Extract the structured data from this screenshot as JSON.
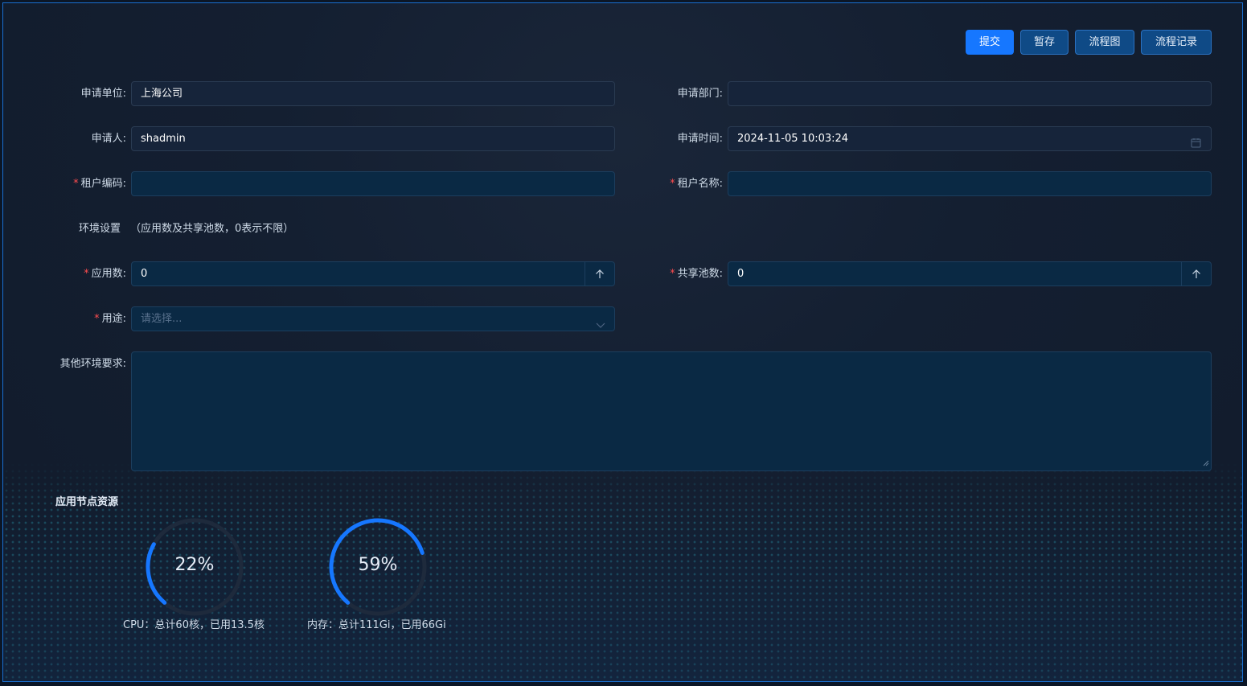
{
  "toolbar": {
    "submit": "提交",
    "save_draft": "暂存",
    "flowchart": "流程图",
    "flow_record": "流程记录"
  },
  "form": {
    "apply_unit": {
      "label": "申请单位:",
      "value": "上海公司"
    },
    "apply_dept": {
      "label": "申请部门:",
      "value": ""
    },
    "applicant": {
      "label": "申请人:",
      "value": "shadmin"
    },
    "apply_time": {
      "label": "申请时间:",
      "value": "2024-11-05 10:03:24"
    },
    "tenant_code": {
      "label": "租户编码:",
      "value": "",
      "required": true
    },
    "tenant_name": {
      "label": "租户名称:",
      "value": "",
      "required": true
    },
    "env_settings": {
      "label": "环境设置",
      "hint": "（应用数及共享池数，0表示不限）"
    },
    "app_count": {
      "label": "应用数:",
      "value": "0",
      "required": true
    },
    "shared_pool_count": {
      "label": "共享池数:",
      "value": "0",
      "required": true
    },
    "purpose": {
      "label": "用途:",
      "placeholder": "请选择...",
      "required": true
    },
    "other_requirements": {
      "label": "其他环境要求:",
      "value": ""
    }
  },
  "resources": {
    "title": "应用节点资源",
    "cpu": {
      "percent": 22,
      "percent_text": "22%",
      "caption": "CPU：总计60核，已用13.5核"
    },
    "memory": {
      "percent": 59,
      "percent_text": "59%",
      "caption": "内存：总计111Gi，已用66Gi"
    }
  },
  "required_mark": "*",
  "colors": {
    "accent": "#1677ff",
    "required": "#ff4d4f",
    "gauge_track": "#1e2a3c"
  },
  "icons": {
    "calendar": "calendar-icon",
    "stepper": "arrow-up-icon",
    "select": "chevron-down-icon"
  }
}
